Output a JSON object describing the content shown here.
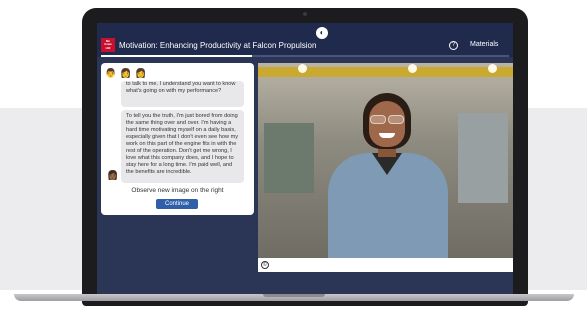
{
  "window": {
    "title": "Motivation: Enhancing Productivity at Falcon Propulsion",
    "materials_label": "Materials",
    "help_icon": "help-circle-icon",
    "center_icon": "globe-icon",
    "progress_fraction": 0.37
  },
  "logo": {
    "lines": [
      "Mc",
      "Graw",
      "Hill"
    ]
  },
  "chat": {
    "avatars": [
      "person-avatar-icon",
      "person-avatar-icon",
      "person-avatar-icon"
    ],
    "message_partial": "to talk to me. I understand you want to know what's going on with my performance?",
    "message_main": "To tell you the truth, I'm just bored from doing the same thing over and over. I'm having a hard time motivating myself on a daily basis, especially given that I don't even see how my work on this part of the engine fits in with the rest of the operation. Don't get me wrong, I love what this company does, and I hope to stay here for a long time. I'm paid well, and the benefits are incredible.",
    "instruction": "Observe new image on the right",
    "continue_label": "Continue"
  },
  "media": {
    "footer_icon": "closed-captions-icon",
    "image_description_icon": "photo-icon"
  },
  "colors": {
    "app_bg": "#2b3657",
    "topbar": "#1f2a4d",
    "accent_button": "#2f5fa8",
    "brand_red": "#c8102e"
  }
}
